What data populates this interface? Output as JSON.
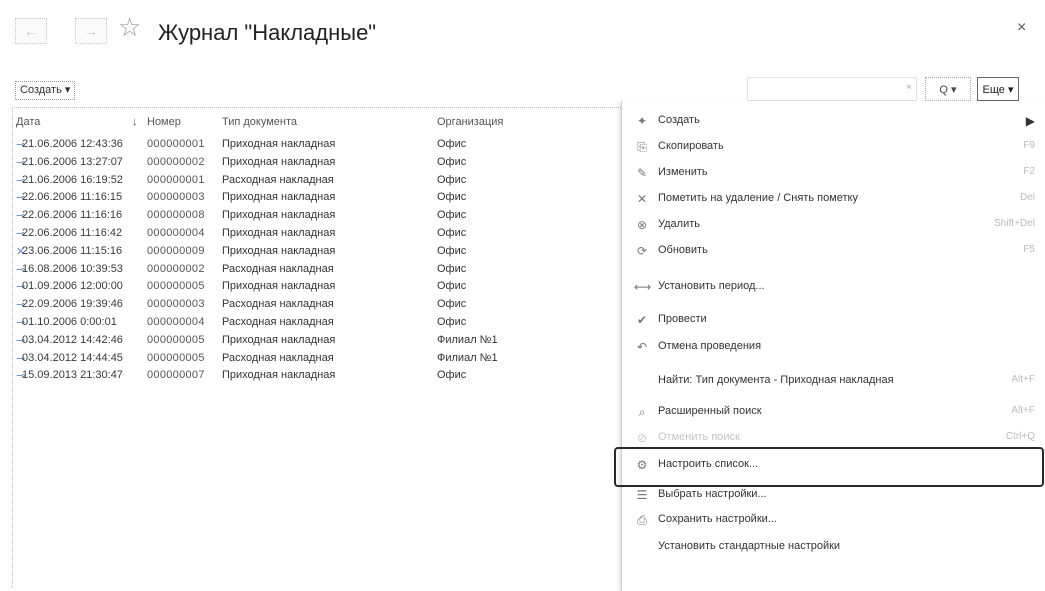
{
  "window": {
    "title": "Журнал \"Накладные\"",
    "close_label": "×",
    "back_label": "←",
    "forward_label": "→"
  },
  "toolbar": {
    "create_label": "Создать ▾",
    "search_clear_label": "×",
    "search_label": "Q ▾",
    "more_label": "Еще ▾"
  },
  "table": {
    "headers": {
      "date": "Дата",
      "sort": "↓",
      "number": "Номер",
      "type": "Тип документа",
      "org": "Организация"
    },
    "rows": [
      {
        "icon": "⊸",
        "date": "21.06.2006 12:43:36",
        "number": "000000001",
        "type": "Приходная накладная",
        "org": "Офис"
      },
      {
        "icon": "⊸",
        "date": "21.06.2006 13:27:07",
        "number": "000000002",
        "type": "Приходная накладная",
        "org": "Офис"
      },
      {
        "icon": "⊸",
        "date": "21.06.2006 16:19:52",
        "number": "000000001",
        "type": "Расходная накладная",
        "org": "Офис"
      },
      {
        "icon": "⊸",
        "date": "22.06.2006 11:16:15",
        "number": "000000003",
        "type": "Приходная накладная",
        "org": "Офис"
      },
      {
        "icon": "⊸",
        "date": "22.06.2006 11:16:16",
        "number": "000000008",
        "type": "Приходная накладная",
        "org": "Офис"
      },
      {
        "icon": "⊸",
        "date": "22.06.2006 11:16:42",
        "number": "000000004",
        "type": "Приходная накладная",
        "org": "Офис"
      },
      {
        "icon": "✕",
        "date": "23.06.2006 11:15:16",
        "number": "000000009",
        "type": "Приходная накладная",
        "org": "Офис"
      },
      {
        "icon": "⊸",
        "date": "16.08.2006 10:39:53",
        "number": "000000002",
        "type": "Расходная накладная",
        "org": "Офис"
      },
      {
        "icon": "⊸",
        "date": "01.09.2006 12:00:00",
        "number": "000000005",
        "type": "Приходная накладная",
        "org": "Офис"
      },
      {
        "icon": "⊸",
        "date": "22.09.2006 19:39:46",
        "number": "000000003",
        "type": "Расходная накладная",
        "org": "Офис"
      },
      {
        "icon": "⊸",
        "date": "01.10.2006 0:00:01",
        "number": "000000004",
        "type": "Расходная накладная",
        "org": "Офис"
      },
      {
        "icon": "⊸",
        "date": "03.04.2012 14:42:46",
        "number": "000000005",
        "type": "Приходная накладная",
        "org": "Филиал №1"
      },
      {
        "icon": "⊸",
        "date": "03.04.2012 14:44:45",
        "number": "000000005",
        "type": "Расходная накладная",
        "org": "Филиал №1"
      },
      {
        "icon": "⊸",
        "date": "15.09.2013 21:30:47",
        "number": "000000007",
        "type": "Приходная накладная",
        "org": "Офис"
      }
    ]
  },
  "menu": {
    "items": [
      {
        "id": "create",
        "icon": "✦",
        "label": "Создать",
        "shortcut": "▶"
      },
      {
        "id": "copy",
        "icon": "⎘",
        "label": "Скопировать",
        "shortcut": "F9"
      },
      {
        "id": "edit",
        "icon": "✎",
        "label": "Изменить",
        "shortcut": "F2"
      },
      {
        "id": "mark-delete",
        "icon": "✕",
        "label": "Пометить на удаление / Снять пометку",
        "shortcut": "Del"
      },
      {
        "id": "delete",
        "icon": "⊗",
        "label": "Удалить",
        "shortcut": "Shift+Del"
      },
      {
        "id": "refresh",
        "icon": "⟳",
        "label": "Обновить",
        "shortcut": "F5"
      },
      {
        "id": "set-period",
        "icon": "⟷",
        "label": "Установить период...",
        "shortcut": ""
      },
      {
        "id": "post",
        "icon": "✔",
        "label": "Провести",
        "shortcut": ""
      },
      {
        "id": "unpost",
        "icon": "↶",
        "label": "Отмена проведения",
        "shortcut": ""
      },
      {
        "id": "find-by",
        "icon": "",
        "label": "Найти: Тип документа - Приходная накладная",
        "shortcut": "Alt+F"
      },
      {
        "id": "advanced-search",
        "icon": "⌕",
        "label": "Расширенный поиск",
        "shortcut": "Alt+F"
      },
      {
        "id": "cancel-search",
        "icon": "⊘",
        "label": "Отменить поиск",
        "shortcut": "Ctrl+Q"
      },
      {
        "id": "configure-list",
        "icon": "⚙",
        "label": "Настроить список...",
        "shortcut": ""
      },
      {
        "id": "select-settings",
        "icon": "☰",
        "label": "Выбрать настройки...",
        "shortcut": ""
      },
      {
        "id": "save-settings",
        "icon": "⎙",
        "label": "Сохранить настройки...",
        "shortcut": ""
      },
      {
        "id": "reset-settings",
        "icon": "",
        "label": "Установить стандартные настройки",
        "shortcut": ""
      }
    ]
  }
}
